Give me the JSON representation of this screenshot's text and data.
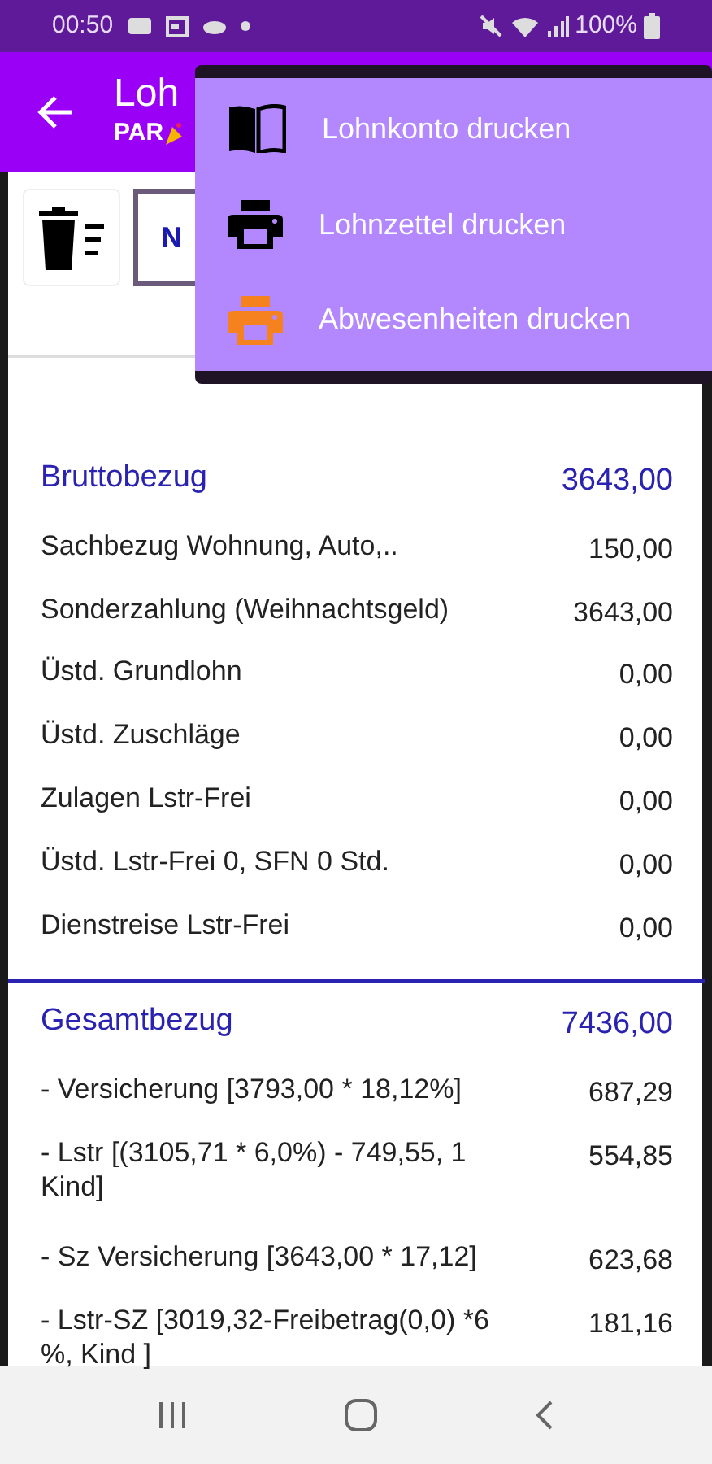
{
  "status_bar": {
    "time": "00:50",
    "battery": "100%"
  },
  "app_bar": {
    "title": "Loh",
    "subtitle": "PAR"
  },
  "toolbar": {
    "next_button": "N"
  },
  "sections": [
    {
      "kind": "total",
      "label": "Bruttobezug",
      "value": "3643,00"
    },
    {
      "kind": "item",
      "label": "Sachbezug Wohnung, Auto,..",
      "value": "150,00"
    },
    {
      "kind": "item",
      "label": "Sonderzahlung (Weihnachtsgeld)",
      "value": "3643,00"
    },
    {
      "kind": "item",
      "label": "Üstd. Grundlohn",
      "value": "0,00"
    },
    {
      "kind": "item",
      "label": "Üstd. Zuschläge",
      "value": "0,00"
    },
    {
      "kind": "item",
      "label": "Zulagen Lstr-Frei",
      "value": "0,00"
    },
    {
      "kind": "item",
      "label": "Üstd. Lstr-Frei 0, SFN 0 Std.",
      "value": "0,00"
    },
    {
      "kind": "item",
      "label": "Dienstreise Lstr-Frei",
      "value": "0,00"
    },
    {
      "kind": "divider"
    },
    {
      "kind": "total",
      "label": "Gesamtbezug",
      "value": "7436,00"
    },
    {
      "kind": "item",
      "label": "- Versicherung [3793,00 * 18,12%]",
      "value": "687,29"
    },
    {
      "kind": "item",
      "label": "- Lstr [(3105,71 * 6,0%) - 749,55, 1 Kind]",
      "value": "554,85"
    },
    {
      "kind": "item",
      "label": "- Sz Versicherung [3643,00 * 17,12]",
      "value": "623,68"
    },
    {
      "kind": "item",
      "label": "- Lstr-SZ [3019,32-Freibetrag(0,0) *6 %, Kind ]",
      "value": "181,16"
    }
  ],
  "menu": [
    {
      "kind": "book",
      "label": "Lohnkonto drucken",
      "color": "#000000"
    },
    {
      "kind": "printer",
      "label": "Lohnzettel drucken",
      "color": "#000000"
    },
    {
      "kind": "printer",
      "label": "Abwesenheiten drucken",
      "color": "#f5821f"
    }
  ]
}
